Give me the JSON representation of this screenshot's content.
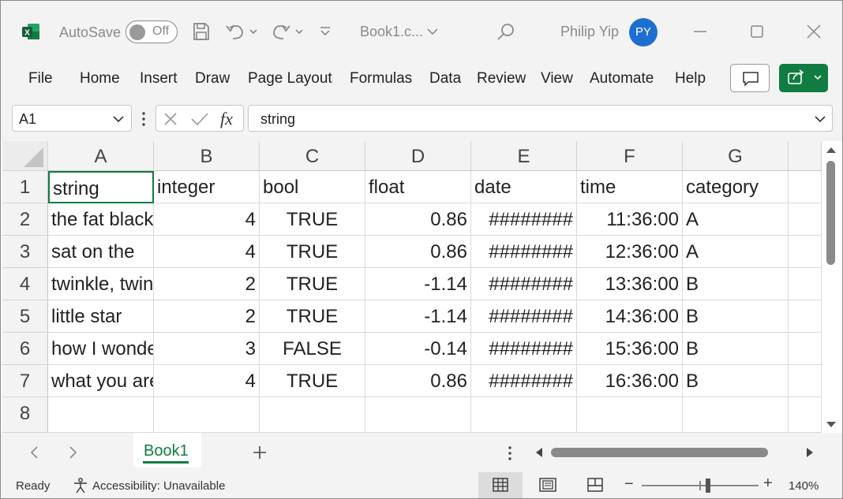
{
  "titlebar": {
    "autosave_label": "AutoSave",
    "autosave_state": "Off",
    "doc_name": "Book1.c...",
    "user_name": "Philip Yip",
    "user_initials": "PY"
  },
  "ribbon": {
    "tabs": [
      "File",
      "Home",
      "Insert",
      "Draw",
      "Page Layout",
      "Formulas",
      "Data",
      "Review",
      "View",
      "Automate",
      "Help"
    ]
  },
  "formula_bar": {
    "name_box": "A1",
    "formula": "string"
  },
  "grid": {
    "columns": [
      "A",
      "B",
      "C",
      "D",
      "E",
      "F",
      "G"
    ],
    "rows": [
      "1",
      "2",
      "3",
      "4",
      "5",
      "6",
      "7",
      "8"
    ],
    "cells": [
      [
        "string",
        "integer",
        "bool",
        "float",
        "date",
        "time",
        "category"
      ],
      [
        "the fat black",
        "4",
        "TRUE",
        "0.86",
        "########",
        "11:36:00",
        "A"
      ],
      [
        "sat on the",
        "4",
        "TRUE",
        "0.86",
        "########",
        "12:36:00",
        "A"
      ],
      [
        "twinkle, twinkle",
        "2",
        "TRUE",
        "-1.14",
        "########",
        "13:36:00",
        "B"
      ],
      [
        "little star",
        "2",
        "TRUE",
        "-1.14",
        "########",
        "14:36:00",
        "B"
      ],
      [
        "how I wonder",
        "3",
        "FALSE",
        "-0.14",
        "########",
        "15:36:00",
        "B"
      ],
      [
        "what you are",
        "4",
        "TRUE",
        "0.86",
        "########",
        "16:36:00",
        "B"
      ],
      [
        "",
        "",
        "",
        "",
        "",
        "",
        ""
      ]
    ]
  },
  "sheets": {
    "active": "Book1"
  },
  "statusbar": {
    "ready": "Ready",
    "accessibility": "Accessibility: Unavailable",
    "zoom": "140%"
  },
  "colors": {
    "accent": "#107c41",
    "avatar": "#1c6fd1"
  }
}
